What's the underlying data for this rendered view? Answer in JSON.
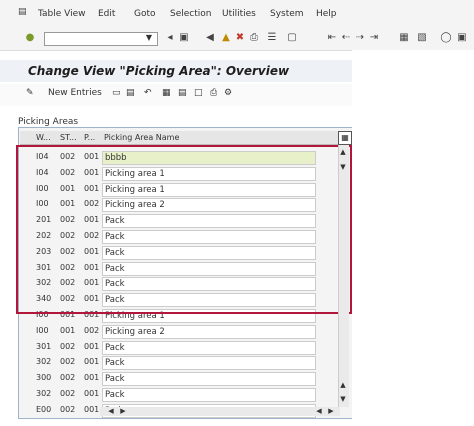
{
  "menu": {
    "items": [
      "Table View",
      "Edit",
      "Goto",
      "Selection",
      "Utilities",
      "System",
      "Help"
    ]
  },
  "window": {
    "title": "Change View \"Picking Area\": Overview"
  },
  "app_toolbar": {
    "new_entries_label": "New Entries"
  },
  "table": {
    "group_label": "Picking Areas",
    "headers": [
      "W...",
      "ST...",
      "P...",
      "Picking Area Name"
    ],
    "rows": [
      {
        "w": "I04",
        "st": "002",
        "p": "001",
        "name": "bbbb",
        "active": true
      },
      {
        "w": "I04",
        "st": "002",
        "p": "001",
        "name": "Picking area 1"
      },
      {
        "w": "I00",
        "st": "001",
        "p": "001",
        "name": "Picking area 1"
      },
      {
        "w": "I00",
        "st": "001",
        "p": "002",
        "name": "Picking area 2"
      },
      {
        "w": "201",
        "st": "002",
        "p": "001",
        "name": "Pack"
      },
      {
        "w": "202",
        "st": "002",
        "p": "002",
        "name": "Pack"
      },
      {
        "w": "203",
        "st": "002",
        "p": "001",
        "name": "Pack"
      },
      {
        "w": "301",
        "st": "002",
        "p": "001",
        "name": "Pack"
      },
      {
        "w": "302",
        "st": "002",
        "p": "001",
        "name": "Pack"
      },
      {
        "w": "340",
        "st": "002",
        "p": "001",
        "name": "Pack"
      },
      {
        "w": "I00",
        "st": "001",
        "p": "001",
        "name": "Picking area 1"
      },
      {
        "w": "I00",
        "st": "001",
        "p": "002",
        "name": "Picking area 2"
      },
      {
        "w": "301",
        "st": "002",
        "p": "001",
        "name": "Pack"
      },
      {
        "w": "302",
        "st": "002",
        "p": "001",
        "name": "Pack"
      },
      {
        "w": "300",
        "st": "002",
        "p": "001",
        "name": "Pack"
      },
      {
        "w": "302",
        "st": "002",
        "p": "001",
        "name": "Pack"
      },
      {
        "w": "E00",
        "st": "002",
        "p": "001",
        "name": "Park"
      }
    ]
  },
  "icons": {
    "grid_settings": "table-settings-icon",
    "scroll_up": "scroll-up-icon",
    "scroll_down": "scroll-down-icon",
    "scroll_left": "scroll-left-icon",
    "scroll_right": "scroll-right-icon"
  },
  "colors": {
    "selection_border": "#b3163b",
    "active_cell": "#e7f0c8"
  }
}
